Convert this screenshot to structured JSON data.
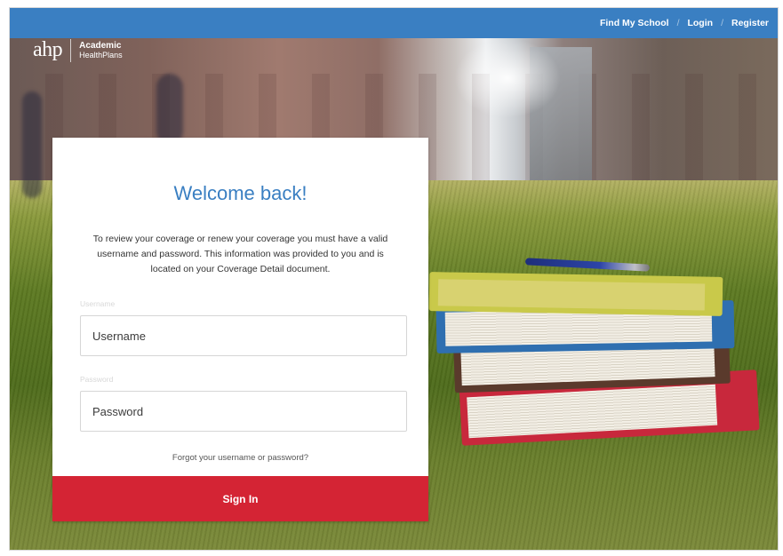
{
  "nav": {
    "links": [
      "Find My School",
      "Login",
      "Register"
    ],
    "separator": "/"
  },
  "logo": {
    "mark": "ahp",
    "line1": "Academic",
    "line2": "HealthPlans"
  },
  "login": {
    "heading": "Welcome back!",
    "intro": "To review your coverage or renew your coverage you must have a valid username and password. This information was provided to you and is located on your Coverage Detail document.",
    "username_label": "Username",
    "username_placeholder": "Username",
    "password_label": "Password",
    "password_placeholder": "Password",
    "forgot_link": "Forgot your username or password?",
    "submit_label": "Sign In"
  },
  "colors": {
    "nav_bg": "#3a7fc2",
    "heading": "#3a7fc2",
    "submit_bg": "#d42434"
  }
}
